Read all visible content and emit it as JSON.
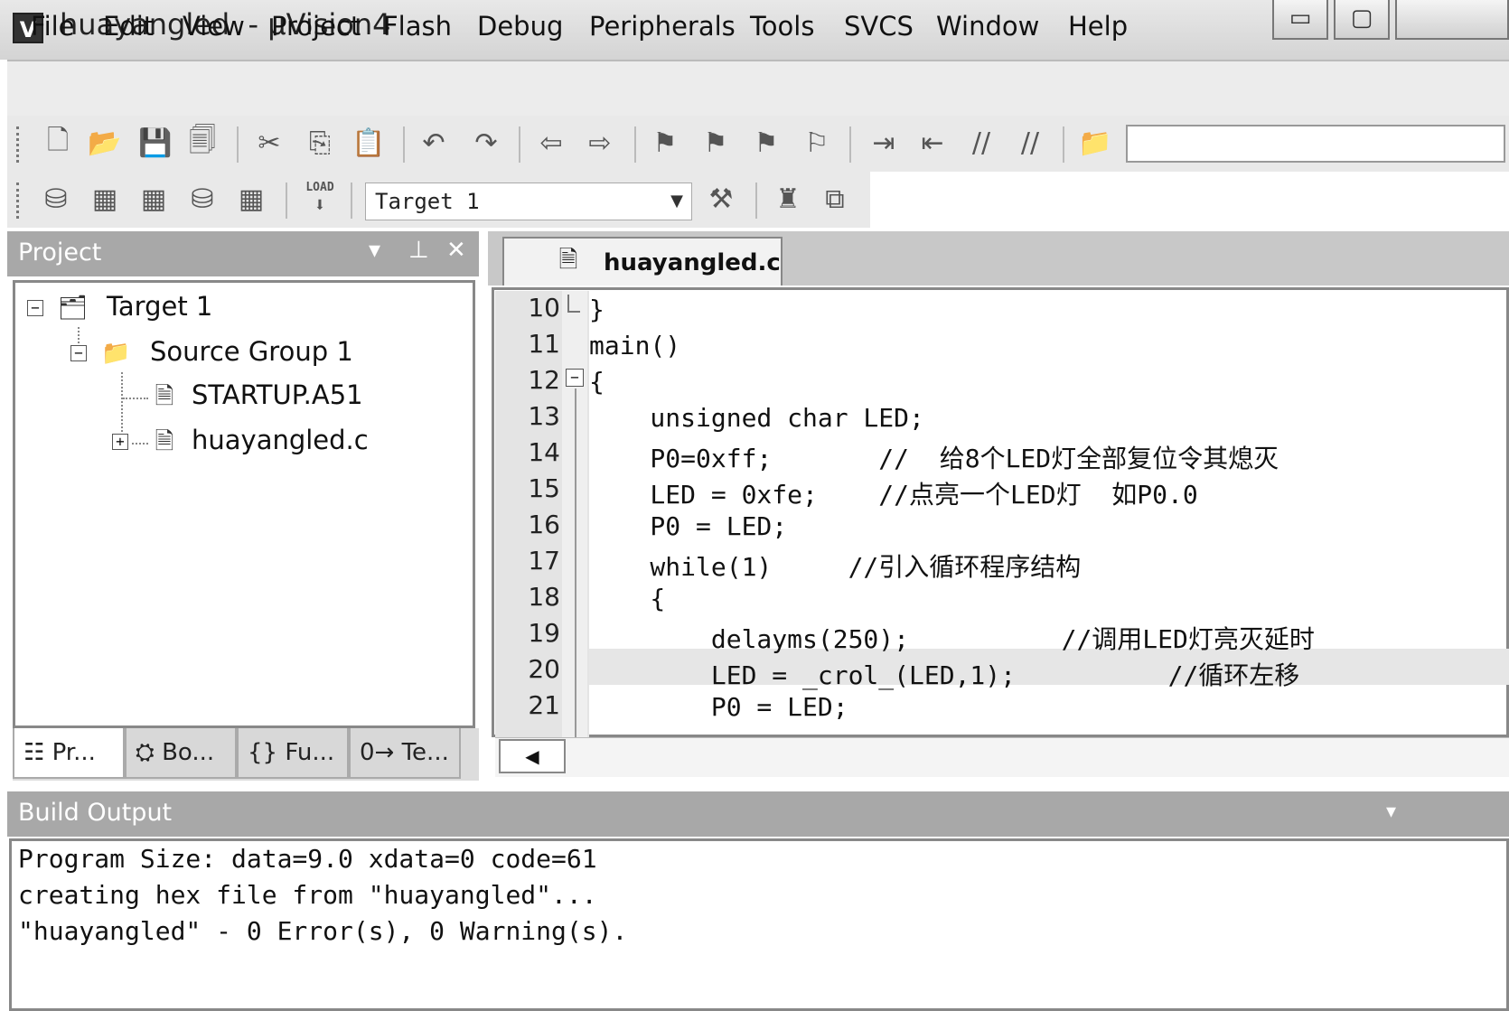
{
  "window": {
    "title": "huayangled  - µVision4",
    "app_icon_glyph": "V",
    "minimize_glyph": "▭",
    "maximize_glyph": "▢"
  },
  "menu": {
    "items": [
      "File",
      "Edit",
      "View",
      "Project",
      "Flash",
      "Debug",
      "Peripherals",
      "Tools",
      "SVCS",
      "Window",
      "Help"
    ]
  },
  "toolbar": {
    "target": "Target 1",
    "load_label": "LOAD",
    "icons": [
      "new-file-icon",
      "open-icon",
      "save-icon",
      "save-all-icon",
      "cut-icon",
      "copy-icon",
      "paste-icon",
      "undo-icon",
      "redo-icon",
      "back-icon",
      "forward-icon",
      "bookmark-icon",
      "bookmark-prev-icon",
      "bookmark-next-icon",
      "bookmark-clear-icon",
      "indent-icon",
      "unindent-icon",
      "comment-icon",
      "uncomment-icon",
      "find-in-files-icon"
    ]
  },
  "project": {
    "title": "Project",
    "tree": {
      "target": "Target 1",
      "group": "Source Group 1",
      "files": [
        "STARTUP.A51",
        "huayangled.c"
      ]
    },
    "tabs": [
      "Pr...",
      "Bo...",
      "Fu...",
      "Te..."
    ]
  },
  "editor": {
    "tab": "huayangled.c",
    "lines": [
      {
        "num": "10",
        "text": "}"
      },
      {
        "num": "11",
        "text": "main()"
      },
      {
        "num": "12",
        "text": "{"
      },
      {
        "num": "13",
        "text": "    unsigned char LED;"
      },
      {
        "num": "14",
        "text": "    P0=0xff;       //  给8个LED灯全部复位令其熄灭"
      },
      {
        "num": "15",
        "text": "    LED = 0xfe;    //点亮一个LED灯  如P0.0"
      },
      {
        "num": "16",
        "text": "    P0 = LED;"
      },
      {
        "num": "17",
        "text": "    while(1)     //引入循环程序结构"
      },
      {
        "num": "18",
        "text": "    {"
      },
      {
        "num": "19",
        "text": "        delayms(250);          //调用LED灯亮灭延时"
      },
      {
        "num": "20",
        "text": "        LED = _crol_(LED,1);          //循环左移"
      },
      {
        "num": "21",
        "text": "        P0 = LED;"
      }
    ]
  },
  "build": {
    "title": "Build Output",
    "lines": [
      "Program Size: data=9.0 xdata=0 code=61",
      "creating hex file from \"huayangled\"...",
      "\"huayangled\" - 0 Error(s), 0 Warning(s)."
    ]
  }
}
